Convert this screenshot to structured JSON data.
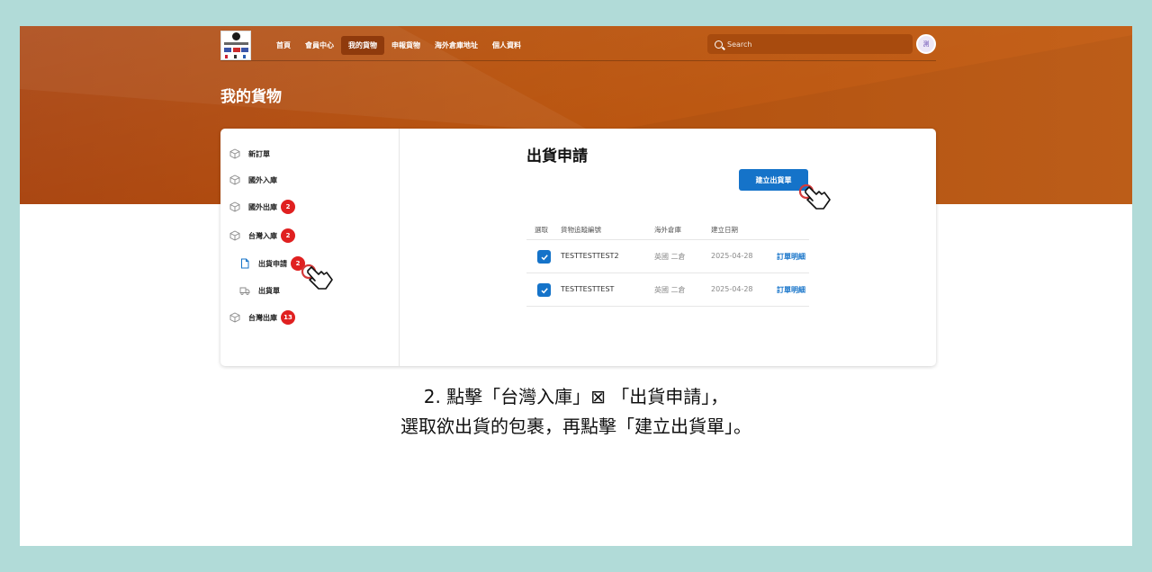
{
  "nav": {
    "links": [
      "首頁",
      "會員中心",
      "我的貨物",
      "申報貨物",
      "海外倉庫地址",
      "個人資料"
    ],
    "active_index": 2,
    "search_placeholder": "Search",
    "avatar_initial": "測"
  },
  "page": {
    "title": "我的貨物"
  },
  "sidebar": {
    "items": [
      {
        "label": "新訂單",
        "icon": "box-icon",
        "badge": ""
      },
      {
        "label": "國外入庫",
        "icon": "box-icon",
        "badge": ""
      },
      {
        "label": "國外出庫",
        "icon": "box-icon",
        "badge": "2"
      },
      {
        "label": "台灣入庫",
        "icon": "box-icon",
        "badge": "2"
      },
      {
        "label": "出貨申請",
        "icon": "document-icon",
        "badge": "2"
      },
      {
        "label": "出貨單",
        "icon": "truck-icon",
        "badge": ""
      },
      {
        "label": "台灣出庫",
        "icon": "box-icon",
        "badge": "13"
      }
    ]
  },
  "main": {
    "title": "出貨申請",
    "create_button": "建立出貨單",
    "table": {
      "headers": [
        "選取",
        "貨物追蹤編號",
        "海外倉庫",
        "建立日期"
      ],
      "rows": [
        {
          "checked": true,
          "tracking": "TESTTESTTEST2",
          "warehouse": "英國 二倉",
          "date": "2025-04-28",
          "action": "訂單明細"
        },
        {
          "checked": true,
          "tracking": "TESTTESTTEST",
          "warehouse": "英國 二倉",
          "date": "2025-04-28",
          "action": "訂單明細"
        }
      ]
    }
  },
  "caption": {
    "line1": "2. 點擊「台灣入庫」⊠ 「出貨申請」，",
    "line2": "選取欲出貨的包裹，再點擊「建立出貨單」。"
  },
  "colors": {
    "hero": "#b4510f",
    "accent": "#1573c9",
    "badge": "#e02020",
    "page_bg": "#b1dbd8"
  }
}
